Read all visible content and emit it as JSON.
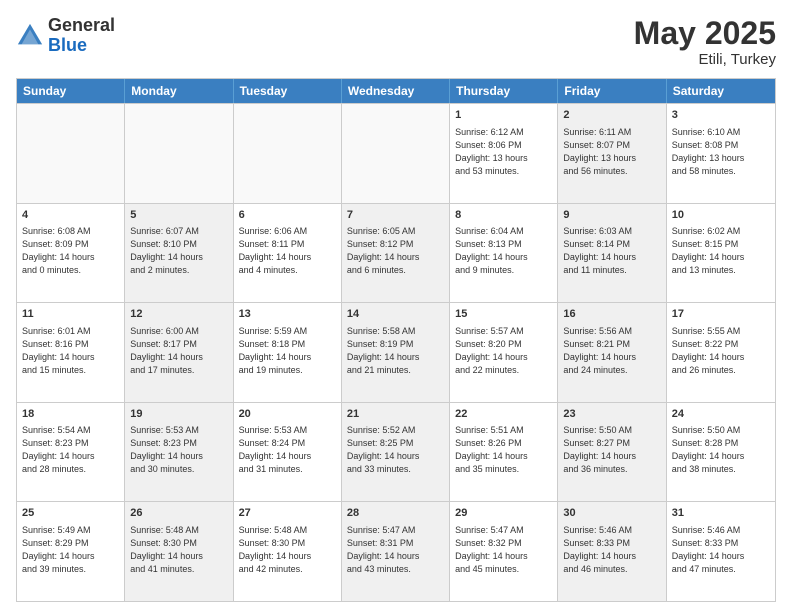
{
  "header": {
    "logo_general": "General",
    "logo_blue": "Blue",
    "month_title": "May 2025",
    "location": "Etili, Turkey"
  },
  "days_of_week": [
    "Sunday",
    "Monday",
    "Tuesday",
    "Wednesday",
    "Thursday",
    "Friday",
    "Saturday"
  ],
  "rows": [
    [
      {
        "day": "",
        "text": "",
        "empty": true
      },
      {
        "day": "",
        "text": "",
        "empty": true
      },
      {
        "day": "",
        "text": "",
        "empty": true
      },
      {
        "day": "",
        "text": "",
        "empty": true
      },
      {
        "day": "1",
        "text": "Sunrise: 6:12 AM\nSunset: 8:06 PM\nDaylight: 13 hours\nand 53 minutes.",
        "empty": false
      },
      {
        "day": "2",
        "text": "Sunrise: 6:11 AM\nSunset: 8:07 PM\nDaylight: 13 hours\nand 56 minutes.",
        "empty": false,
        "shaded": true
      },
      {
        "day": "3",
        "text": "Sunrise: 6:10 AM\nSunset: 8:08 PM\nDaylight: 13 hours\nand 58 minutes.",
        "empty": false
      }
    ],
    [
      {
        "day": "4",
        "text": "Sunrise: 6:08 AM\nSunset: 8:09 PM\nDaylight: 14 hours\nand 0 minutes.",
        "empty": false
      },
      {
        "day": "5",
        "text": "Sunrise: 6:07 AM\nSunset: 8:10 PM\nDaylight: 14 hours\nand 2 minutes.",
        "empty": false,
        "shaded": true
      },
      {
        "day": "6",
        "text": "Sunrise: 6:06 AM\nSunset: 8:11 PM\nDaylight: 14 hours\nand 4 minutes.",
        "empty": false
      },
      {
        "day": "7",
        "text": "Sunrise: 6:05 AM\nSunset: 8:12 PM\nDaylight: 14 hours\nand 6 minutes.",
        "empty": false,
        "shaded": true
      },
      {
        "day": "8",
        "text": "Sunrise: 6:04 AM\nSunset: 8:13 PM\nDaylight: 14 hours\nand 9 minutes.",
        "empty": false
      },
      {
        "day": "9",
        "text": "Sunrise: 6:03 AM\nSunset: 8:14 PM\nDaylight: 14 hours\nand 11 minutes.",
        "empty": false,
        "shaded": true
      },
      {
        "day": "10",
        "text": "Sunrise: 6:02 AM\nSunset: 8:15 PM\nDaylight: 14 hours\nand 13 minutes.",
        "empty": false
      }
    ],
    [
      {
        "day": "11",
        "text": "Sunrise: 6:01 AM\nSunset: 8:16 PM\nDaylight: 14 hours\nand 15 minutes.",
        "empty": false
      },
      {
        "day": "12",
        "text": "Sunrise: 6:00 AM\nSunset: 8:17 PM\nDaylight: 14 hours\nand 17 minutes.",
        "empty": false,
        "shaded": true
      },
      {
        "day": "13",
        "text": "Sunrise: 5:59 AM\nSunset: 8:18 PM\nDaylight: 14 hours\nand 19 minutes.",
        "empty": false
      },
      {
        "day": "14",
        "text": "Sunrise: 5:58 AM\nSunset: 8:19 PM\nDaylight: 14 hours\nand 21 minutes.",
        "empty": false,
        "shaded": true
      },
      {
        "day": "15",
        "text": "Sunrise: 5:57 AM\nSunset: 8:20 PM\nDaylight: 14 hours\nand 22 minutes.",
        "empty": false
      },
      {
        "day": "16",
        "text": "Sunrise: 5:56 AM\nSunset: 8:21 PM\nDaylight: 14 hours\nand 24 minutes.",
        "empty": false,
        "shaded": true
      },
      {
        "day": "17",
        "text": "Sunrise: 5:55 AM\nSunset: 8:22 PM\nDaylight: 14 hours\nand 26 minutes.",
        "empty": false
      }
    ],
    [
      {
        "day": "18",
        "text": "Sunrise: 5:54 AM\nSunset: 8:23 PM\nDaylight: 14 hours\nand 28 minutes.",
        "empty": false
      },
      {
        "day": "19",
        "text": "Sunrise: 5:53 AM\nSunset: 8:23 PM\nDaylight: 14 hours\nand 30 minutes.",
        "empty": false,
        "shaded": true
      },
      {
        "day": "20",
        "text": "Sunrise: 5:53 AM\nSunset: 8:24 PM\nDaylight: 14 hours\nand 31 minutes.",
        "empty": false
      },
      {
        "day": "21",
        "text": "Sunrise: 5:52 AM\nSunset: 8:25 PM\nDaylight: 14 hours\nand 33 minutes.",
        "empty": false,
        "shaded": true
      },
      {
        "day": "22",
        "text": "Sunrise: 5:51 AM\nSunset: 8:26 PM\nDaylight: 14 hours\nand 35 minutes.",
        "empty": false
      },
      {
        "day": "23",
        "text": "Sunrise: 5:50 AM\nSunset: 8:27 PM\nDaylight: 14 hours\nand 36 minutes.",
        "empty": false,
        "shaded": true
      },
      {
        "day": "24",
        "text": "Sunrise: 5:50 AM\nSunset: 8:28 PM\nDaylight: 14 hours\nand 38 minutes.",
        "empty": false
      }
    ],
    [
      {
        "day": "25",
        "text": "Sunrise: 5:49 AM\nSunset: 8:29 PM\nDaylight: 14 hours\nand 39 minutes.",
        "empty": false
      },
      {
        "day": "26",
        "text": "Sunrise: 5:48 AM\nSunset: 8:30 PM\nDaylight: 14 hours\nand 41 minutes.",
        "empty": false,
        "shaded": true
      },
      {
        "day": "27",
        "text": "Sunrise: 5:48 AM\nSunset: 8:30 PM\nDaylight: 14 hours\nand 42 minutes.",
        "empty": false
      },
      {
        "day": "28",
        "text": "Sunrise: 5:47 AM\nSunset: 8:31 PM\nDaylight: 14 hours\nand 43 minutes.",
        "empty": false,
        "shaded": true
      },
      {
        "day": "29",
        "text": "Sunrise: 5:47 AM\nSunset: 8:32 PM\nDaylight: 14 hours\nand 45 minutes.",
        "empty": false
      },
      {
        "day": "30",
        "text": "Sunrise: 5:46 AM\nSunset: 8:33 PM\nDaylight: 14 hours\nand 46 minutes.",
        "empty": false,
        "shaded": true
      },
      {
        "day": "31",
        "text": "Sunrise: 5:46 AM\nSunset: 8:33 PM\nDaylight: 14 hours\nand 47 minutes.",
        "empty": false
      }
    ]
  ]
}
